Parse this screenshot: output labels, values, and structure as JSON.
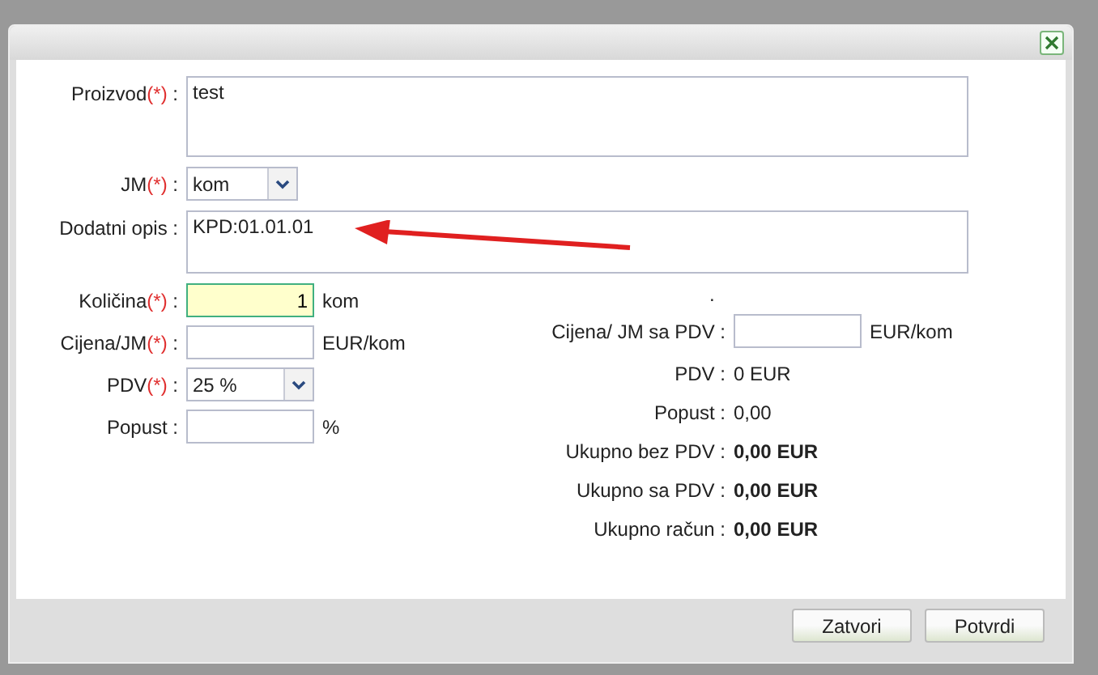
{
  "top_fields": [
    {
      "kind": "textarea",
      "label": "Proizvod",
      "required_mark": "(*)",
      "colon": ":",
      "value": "test"
    },
    {
      "kind": "select",
      "label": "JM",
      "required_mark": "(*)",
      "colon": ":",
      "value": "kom"
    },
    {
      "kind": "textarea",
      "label": "Dodatni opis",
      "colon": ":",
      "value": "KPD:01.01.01"
    }
  ],
  "left_fields": [
    {
      "kind": "input",
      "label": "Količina",
      "required_mark": "(*)",
      "colon": ":",
      "value": "1",
      "unit": "kom",
      "focused": true
    },
    {
      "kind": "input",
      "label": "Cijena/JM",
      "required_mark": "(*)",
      "colon": ":",
      "unit": "EUR/kom",
      "focused": false
    },
    {
      "kind": "select",
      "label": "PDV",
      "required_mark": "(*)",
      "colon": ":",
      "value": "25 %"
    },
    {
      "kind": "input",
      "label": "Popust",
      "colon": ":",
      "unit": "%",
      "focused": false
    }
  ],
  "right_note": ".",
  "right_fields": [
    {
      "kind": "input",
      "label": "Cijena/ JM sa PDV",
      "colon": ":",
      "unit": "EUR/kom"
    },
    {
      "kind": "value",
      "label": "PDV",
      "colon": ":",
      "value": "0 EUR"
    },
    {
      "kind": "value",
      "label": "Popust",
      "colon": ":",
      "value": "0,00"
    },
    {
      "kind": "total",
      "label": "Ukupno bez PDV",
      "colon": ":",
      "value": "0,00 EUR"
    },
    {
      "kind": "total",
      "label": "Ukupno sa PDV",
      "colon": ":",
      "value": "0,00 EUR"
    },
    {
      "kind": "total",
      "label": "Ukupno račun",
      "colon": ":",
      "value": "0,00 EUR"
    }
  ],
  "buttons": [
    "Zatvori",
    "Potvrdi"
  ]
}
